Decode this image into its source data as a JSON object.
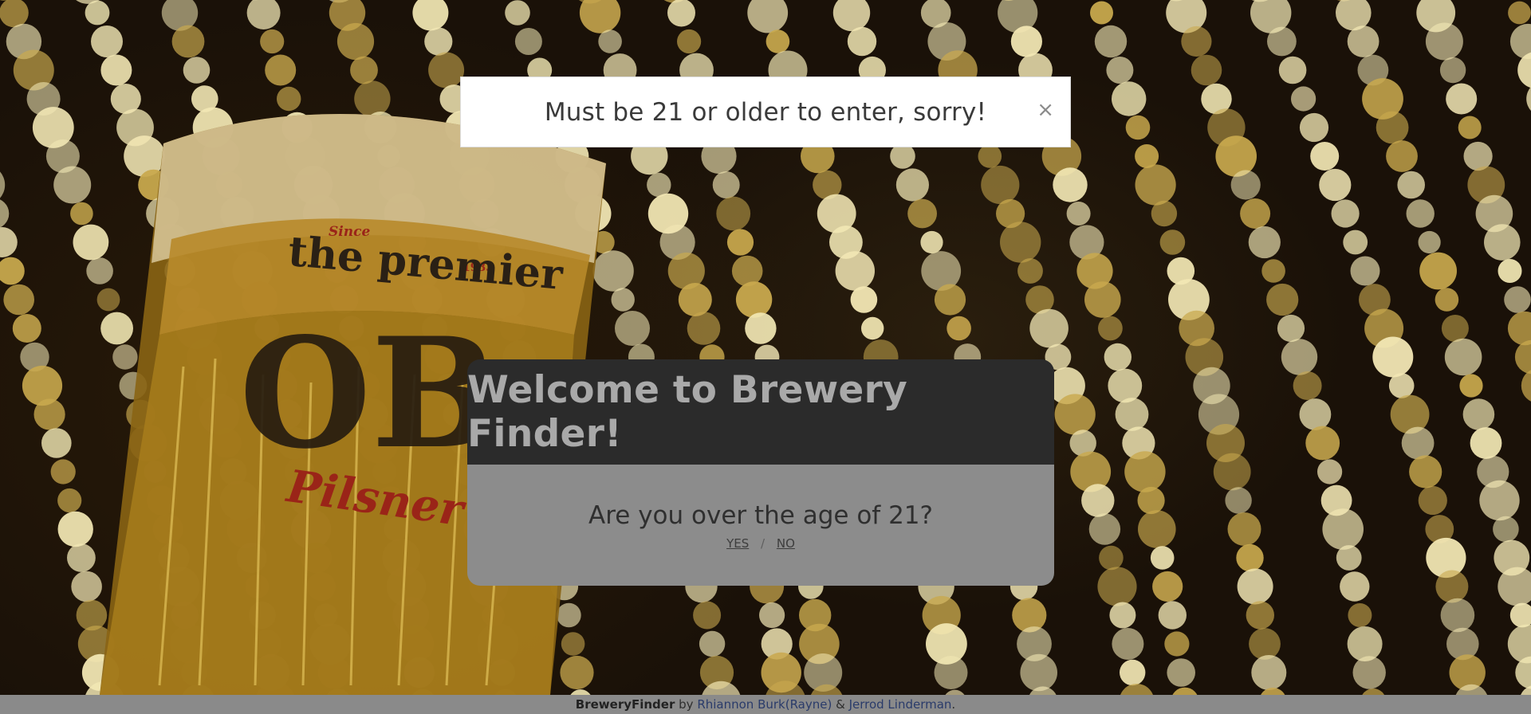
{
  "alert": {
    "message": "Must be 21 or older to enter, sorry!",
    "close_glyph": "×"
  },
  "modal": {
    "title": "Welcome to Brewery Finder!",
    "question": "Are you over the age of 21?",
    "yes_label": "YES",
    "separator": "/",
    "no_label": "NO"
  },
  "background": {
    "glass_brand": "the premier",
    "glass_logo": "OB",
    "glass_script": "Pilsner",
    "glass_since": "Since",
    "glass_year": "1933"
  },
  "footer": {
    "brand": "BreweryFinder",
    "by_text": " by ",
    "author1": "Rhiannon Burk(Rayne)",
    "and_text": " & ",
    "author2": "Jerrod Linderman",
    "end_text": "."
  }
}
